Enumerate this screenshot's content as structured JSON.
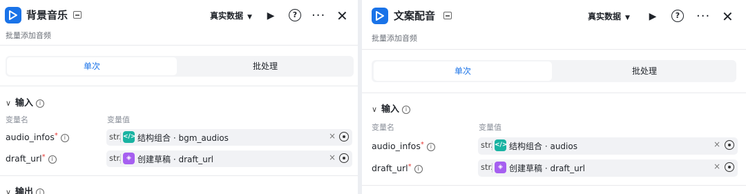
{
  "panels": [
    {
      "title": "背景音乐",
      "subtitle": "批量添加音频",
      "data_dropdown": "真实数据",
      "tabs": [
        "单次",
        "批处理"
      ],
      "input_section": "输入",
      "output_section": "输出",
      "col_name": "变量名",
      "col_value": "变量值",
      "vars": [
        {
          "name": "audio_infos",
          "type": "str.",
          "source": "结构组合",
          "field": "bgm_audios",
          "icon": "code-icon"
        },
        {
          "name": "draft_url",
          "type": "str.",
          "source": "创建草稿",
          "field": "draft_url",
          "icon": "cube-icon"
        }
      ]
    },
    {
      "title": "文案配音",
      "subtitle": "批量添加音频",
      "data_dropdown": "真实数据",
      "tabs": [
        "单次",
        "批处理"
      ],
      "input_section": "输入",
      "col_name": "变量名",
      "col_value": "变量值",
      "vars": [
        {
          "name": "audio_infos",
          "type": "str.",
          "source": "结构组合",
          "field": "audios",
          "icon": "code-icon"
        },
        {
          "name": "draft_url",
          "type": "str.",
          "source": "创建草稿",
          "field": "draft_url",
          "icon": "cube-icon"
        }
      ]
    }
  ],
  "icons": {
    "play": "▶",
    "help": "?",
    "more": "···",
    "close": "✕",
    "clear": "×",
    "chevron": "∨",
    "info": "i"
  },
  "colors": {
    "accent": "#1a73e8",
    "required": "#e53935",
    "teal_node": "#19b3a2",
    "purple_node": "#a65ff0"
  }
}
